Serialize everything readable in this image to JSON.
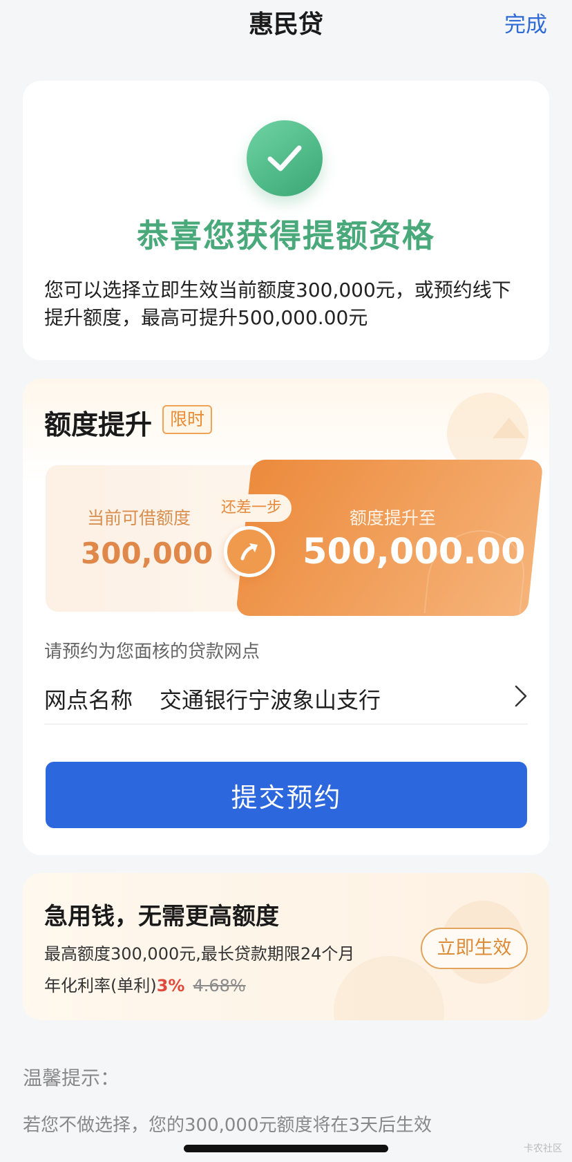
{
  "header": {
    "title": "惠民贷",
    "done_label": "完成"
  },
  "success": {
    "icon": "check-icon",
    "title": "恭喜您获得提额资格",
    "desc": "您可以选择立即生效当前额度300,000元，或预约线下提升额度，最高可提升500,000.00元"
  },
  "raise": {
    "title": "额度提升",
    "badge": "限时",
    "current_label": "当前可借额度",
    "current_value": "300,000",
    "step_label": "还差一步",
    "upgraded_label": "额度提升至",
    "upgraded_value": "500,000.00",
    "reserve_hint": "请预约为您面核的贷款网点",
    "branch_label": "网点名称",
    "branch_value": "交通银行宁波象山支行",
    "submit_label": "提交预约"
  },
  "urgent": {
    "title": "急用钱，无需更高额度",
    "line": "最高额度300,000元,最长贷款期限24个月",
    "rate_prefix": "年化利率(单利)",
    "rate_now": "3%",
    "rate_old": "4.68%",
    "activate_label": "立即生效"
  },
  "tips": {
    "title": "温馨提示：",
    "text": "若您不做选择，您的300,000元额度将在3天后生效"
  },
  "watermark": "卡农社区",
  "colors": {
    "accent_blue": "#2d67de",
    "success_green": "#4aa97a",
    "orange": "#ec8a3c",
    "rate_red": "#e04a3c"
  }
}
